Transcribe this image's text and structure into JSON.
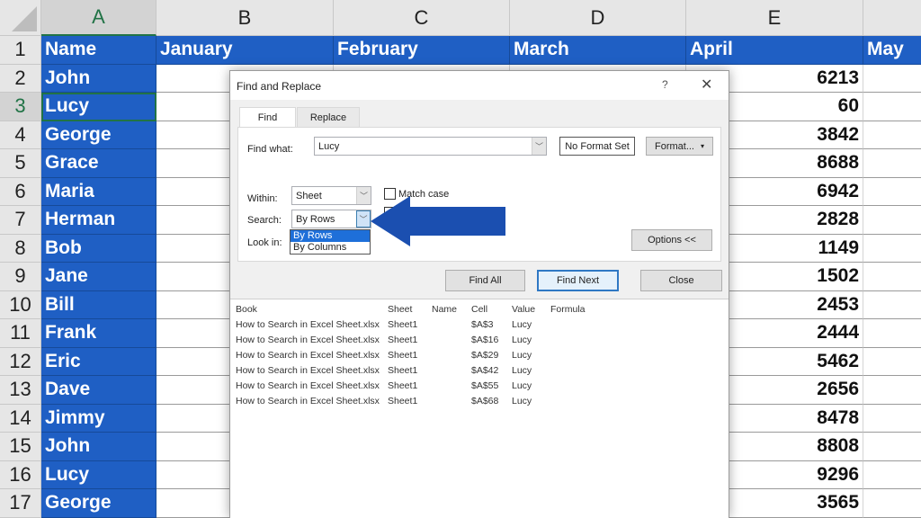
{
  "sheet": {
    "columns": [
      "A",
      "B",
      "C",
      "D",
      "E",
      ""
    ],
    "selected_column": "A",
    "row_numbers": [
      "1",
      "2",
      "3",
      "4",
      "5",
      "6",
      "7",
      "8",
      "9",
      "10",
      "11",
      "12",
      "13",
      "14",
      "15",
      "16",
      "17"
    ],
    "active_row": "3",
    "header_row": [
      "Name",
      "January",
      "February",
      "March",
      "April",
      "May"
    ],
    "names": [
      "John",
      "Lucy",
      "George",
      "Grace",
      "Maria",
      "Herman",
      "Bob",
      "Jane",
      "Bill",
      "Frank",
      "Eric",
      "Dave",
      "Jimmy",
      "John",
      "Lucy",
      "George"
    ],
    "april_values": [
      "6213",
      "60",
      "3842",
      "8688",
      "6942",
      "2828",
      "1149",
      "1502",
      "2453",
      "2444",
      "5462",
      "2656",
      "8478",
      "8808",
      "9296",
      "3565"
    ],
    "header_color": "#1f5fc4"
  },
  "dialog": {
    "title": "Find and Replace",
    "help_icon": "?",
    "close_icon": "✕",
    "tabs": [
      {
        "label": "Find",
        "active": true
      },
      {
        "label": "Replace",
        "active": false
      }
    ],
    "find_what_label": "Find what:",
    "find_what_value": "Lucy",
    "no_format_set": "No Format Set",
    "format_button": "Format...",
    "within_label": "Within:",
    "within_value": "Sheet",
    "search_label": "Search:",
    "search_value": "By Rows",
    "search_options": [
      "By Rows",
      "By Columns"
    ],
    "search_option_highlighted": "By Rows",
    "look_in_label": "Look in:",
    "match_case_label": "Match case",
    "options_button": "Options <<",
    "find_all_button": "Find All",
    "find_next_button": "Find Next",
    "close_button": "Close",
    "results": {
      "headers": [
        "Book",
        "Sheet",
        "Name",
        "Cell",
        "Value",
        "Formula"
      ],
      "rows": [
        [
          "How to Search in Excel Sheet.xlsx",
          "Sheet1",
          "",
          "$A$3",
          "Lucy",
          ""
        ],
        [
          "How to Search in Excel Sheet.xlsx",
          "Sheet1",
          "",
          "$A$16",
          "Lucy",
          ""
        ],
        [
          "How to Search in Excel Sheet.xlsx",
          "Sheet1",
          "",
          "$A$29",
          "Lucy",
          ""
        ],
        [
          "How to Search in Excel Sheet.xlsx",
          "Sheet1",
          "",
          "$A$42",
          "Lucy",
          ""
        ],
        [
          "How to Search in Excel Sheet.xlsx",
          "Sheet1",
          "",
          "$A$55",
          "Lucy",
          ""
        ],
        [
          "How to Search in Excel Sheet.xlsx",
          "Sheet1",
          "",
          "$A$68",
          "Lucy",
          ""
        ]
      ]
    }
  },
  "annotation": {
    "arrow_color": "#1b4fb0",
    "arrow_icon": "left-arrow"
  }
}
